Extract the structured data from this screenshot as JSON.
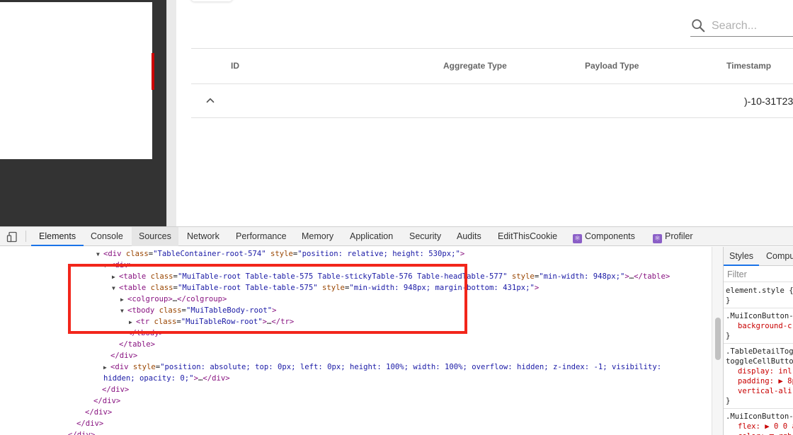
{
  "app": {
    "search": {
      "placeholder": "Search..."
    },
    "table": {
      "headers": [
        "ID",
        "Aggregate Type",
        "Payload Type",
        "Timestamp"
      ],
      "row": {
        "timestamp": ")-10-31T23"
      }
    }
  },
  "devtools": {
    "tabs": [
      "Elements",
      "Console",
      "Sources",
      "Network",
      "Performance",
      "Memory",
      "Application",
      "Security",
      "Audits",
      "EditThisCookie",
      "Components",
      "Profiler"
    ],
    "styles_tabs": [
      "Styles",
      "Compu"
    ],
    "styles_filter_placeholder": "Filter",
    "dom_lines": [
      {
        "tri": "▼",
        "parts": [
          [
            "tag",
            "<div "
          ],
          [
            "attr",
            "class"
          ],
          [
            "plain",
            "="
          ],
          [
            "val",
            "\"TableContainer-root-574\" "
          ],
          [
            "attr",
            "style"
          ],
          [
            "plain",
            "="
          ],
          [
            "val",
            "\"position: relative; height: 530px;\""
          ],
          [
            "tag",
            ">"
          ]
        ]
      },
      {
        "tri": "▼",
        "parts": [
          [
            "tag",
            "<div>"
          ]
        ]
      },
      {
        "tri": "▶",
        "parts": [
          [
            "tag",
            "<table "
          ],
          [
            "attr",
            "class"
          ],
          [
            "plain",
            "="
          ],
          [
            "val",
            "\"MuiTable-root Table-table-575 Table-stickyTable-576 Table-headTable-577\" "
          ],
          [
            "attr",
            "style"
          ],
          [
            "plain",
            "="
          ],
          [
            "val",
            "\"min-width: 948px;\""
          ],
          [
            "tag",
            ">"
          ],
          [
            "plain",
            "…"
          ],
          [
            "tag",
            "</table>"
          ]
        ]
      },
      {
        "tri": "▼",
        "parts": [
          [
            "tag",
            "<table "
          ],
          [
            "attr",
            "class"
          ],
          [
            "plain",
            "="
          ],
          [
            "val",
            "\"MuiTable-root Table-table-575\" "
          ],
          [
            "attr",
            "style"
          ],
          [
            "plain",
            "="
          ],
          [
            "val",
            "\"min-width: 948px; margin-bottom: 431px;\""
          ],
          [
            "tag",
            ">"
          ]
        ]
      },
      {
        "tri": "▶",
        "parts": [
          [
            "tag",
            "<colgroup>"
          ],
          [
            "plain",
            "…"
          ],
          [
            "tag",
            "</colgroup>"
          ]
        ]
      },
      {
        "tri": "▼",
        "parts": [
          [
            "tag",
            "<tbody "
          ],
          [
            "attr",
            "class"
          ],
          [
            "plain",
            "="
          ],
          [
            "val",
            "\"MuiTableBody-root\""
          ],
          [
            "tag",
            ">"
          ]
        ]
      },
      {
        "tri": "▶",
        "parts": [
          [
            "tag",
            "<tr "
          ],
          [
            "attr",
            "class"
          ],
          [
            "plain",
            "="
          ],
          [
            "val",
            "\"MuiTableRow-root\""
          ],
          [
            "tag",
            ">"
          ],
          [
            "plain",
            "…"
          ],
          [
            "tag",
            "</tr>"
          ]
        ]
      },
      {
        "tri": "",
        "parts": [
          [
            "tag",
            "</tbody>"
          ]
        ]
      },
      {
        "tri": "",
        "parts": [
          [
            "tag",
            "</table>"
          ]
        ]
      },
      {
        "tri": "",
        "parts": [
          [
            "tag",
            "</div>"
          ]
        ]
      },
      {
        "tri": "▶",
        "parts": [
          [
            "tag",
            "<div "
          ],
          [
            "attr",
            "style"
          ],
          [
            "plain",
            "="
          ],
          [
            "val",
            "\"position: absolute; top: 0px; left: 0px; height: 100%; width: 100%; overflow: hidden; z-index: -1; visibility:"
          ]
        ]
      },
      {
        "tri": "",
        "parts": [
          [
            "val",
            "hidden; opacity: 0;\""
          ],
          [
            "tag",
            ">"
          ],
          [
            "plain",
            "…"
          ],
          [
            "tag",
            "</div>"
          ]
        ]
      },
      {
        "tri": "",
        "parts": [
          [
            "tag",
            "</div>"
          ]
        ]
      },
      {
        "tri": "",
        "parts": [
          [
            "tag",
            "</div>"
          ]
        ]
      },
      {
        "tri": "",
        "parts": [
          [
            "tag",
            "</div>"
          ]
        ]
      },
      {
        "tri": "",
        "parts": [
          [
            "tag",
            "</div>"
          ]
        ]
      },
      {
        "tri": "",
        "parts": [
          [
            "tag",
            "</div>"
          ]
        ]
      }
    ],
    "styles_lines": [
      {
        "kind": "text",
        "text": "element.style {"
      },
      {
        "kind": "text",
        "text": "}"
      },
      {
        "kind": "rule"
      },
      {
        "kind": "text",
        "text": ".MuiIconButton-"
      },
      {
        "kind": "prop",
        "text": "background-c"
      },
      {
        "kind": "text",
        "text": "}"
      },
      {
        "kind": "rule"
      },
      {
        "kind": "text",
        "text": ".TableDetailTog"
      },
      {
        "kind": "text",
        "text": "toggleCellButto"
      },
      {
        "kind": "prop",
        "text": "display: inl"
      },
      {
        "kind": "prop",
        "text": "padding: ▶ 8p"
      },
      {
        "kind": "prop",
        "text": "vertical-ali"
      },
      {
        "kind": "text",
        "text": "}"
      },
      {
        "kind": "rule"
      },
      {
        "kind": "text",
        "text": ".MuiIconButton-"
      },
      {
        "kind": "prop",
        "text": "flex: ▶ 0 0 a"
      },
      {
        "kind": "prop",
        "text": "color: ■ rgb"
      }
    ]
  }
}
